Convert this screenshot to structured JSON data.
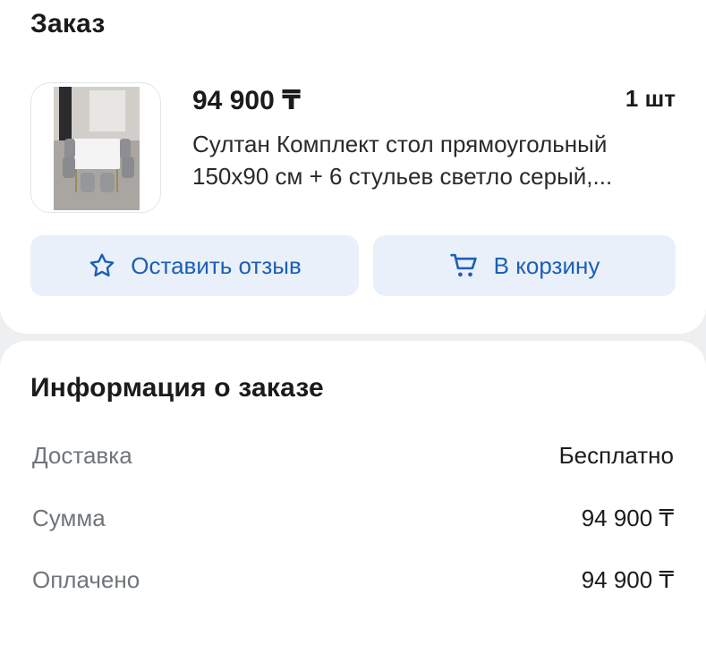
{
  "order": {
    "title": "Заказ",
    "item": {
      "price": "94 900 ₸",
      "quantity": "1 шт",
      "name": "Султан Комплект стол прямоугольный 150х90 см + 6 стульев светло серый,..."
    },
    "actions": {
      "review_label": "Оставить отзыв",
      "review_icon": "star-outline-icon",
      "cart_label": "В корзину",
      "cart_icon": "cart-icon"
    }
  },
  "info": {
    "title": "Информация о заказе",
    "rows": [
      {
        "label": "Доставка",
        "value": "Бесплатно"
      },
      {
        "label": "Сумма",
        "value": "94 900 ₸"
      },
      {
        "label": "Оплачено",
        "value": "94 900 ₸"
      }
    ]
  },
  "colors": {
    "accent": "#1d5fb4",
    "button_bg": "#e9f0f9",
    "page_bg": "#eeeff1",
    "muted_text": "#707579"
  }
}
